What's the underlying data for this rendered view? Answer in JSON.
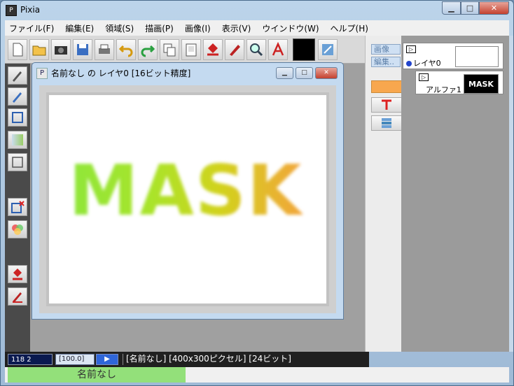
{
  "window": {
    "title": "Pixia",
    "app_icon": "pixia-logo-icon",
    "minimize": "▁",
    "maximize": "□",
    "close": "✕"
  },
  "menu": [
    {
      "label": "ファイル(F)"
    },
    {
      "label": "編集(E)"
    },
    {
      "label": "領域(S)"
    },
    {
      "label": "描画(P)"
    },
    {
      "label": "画像(I)"
    },
    {
      "label": "表示(V)"
    },
    {
      "label": "ウインドウ(W)"
    },
    {
      "label": "ヘルプ(H)"
    }
  ],
  "toolbar": {
    "icons": [
      "new-document-icon",
      "open-folder-icon",
      "camera-icon",
      "save-disk-icon",
      "print-icon",
      "undo-icon",
      "redo-icon",
      "copy-icon",
      "paste-icon",
      "paint-bucket-icon",
      "pen-tool-icon",
      "zoom-icon",
      "text-a-icon",
      "color-swatch",
      "transform-icon"
    ],
    "current_color": "#000000"
  },
  "document": {
    "title": "名前なし の レイヤ0 [16ビット精度]",
    "canvas_text": "MASK"
  },
  "right_panel": {
    "tab_image": "画像",
    "tab_edit": "編集..",
    "swatch_color": "#f8a74e"
  },
  "layers": {
    "layer0_name": "レイヤ0",
    "alpha_name": "アルファ1",
    "alpha_thumb_text": "MASK"
  },
  "status": {
    "coords": "118 2",
    "zoom": "[100.0]",
    "info": "[名前なし] [400x300ピクセル] [24ビット]"
  },
  "tabs": {
    "active_doc": "名前なし"
  }
}
